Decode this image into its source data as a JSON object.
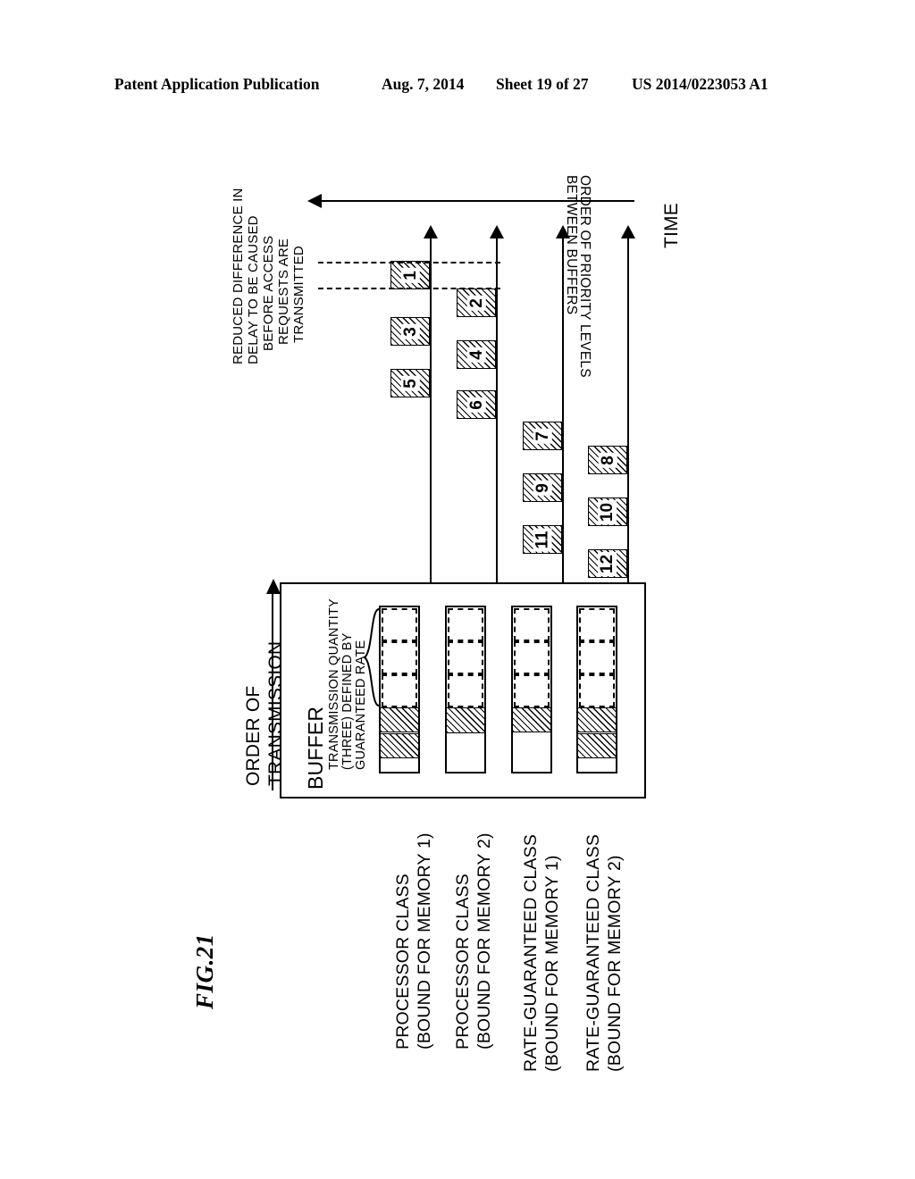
{
  "header": {
    "publication": "Patent Application Publication",
    "date": "Aug. 7, 2014",
    "sheet": "Sheet 19 of 27",
    "number": "US 2014/0223053 A1"
  },
  "figure": {
    "label": "FIG.21",
    "annotations": {
      "reduced_delay": "REDUCED DIFFERENCE IN DELAY TO BE CAUSED BEFORE ACCESS REQUESTS ARE TRANSMITTED",
      "reduced_delay_lines": [
        "REDUCED DIFFERENCE IN",
        "DELAY TO BE CAUSED",
        "BEFORE ACCESS",
        "REQUESTS ARE",
        "TRANSMITTED"
      ],
      "priority_order": "ORDER OF PRIORITY LEVELS BETWEEN BUFFERS",
      "priority_order_lines": [
        "ORDER OF PRIORITY LEVELS",
        "BETWEEN BUFFERS"
      ],
      "time_axis": "TIME",
      "order_of_transmission": "ORDER OF TRANSMISSION",
      "order_of_transmission_lines": [
        "ORDER OF",
        "TRANSMISSION"
      ],
      "buffer_title": "BUFFER",
      "transmission_quantity": "TRANSMISSION QUANTITY (THREE) DEFINED BY GUARANTEED RATE",
      "transmission_quantity_lines": [
        "TRANSMISSION QUANTITY",
        "(THREE) DEFINED BY",
        "GUARANTEED RATE"
      ]
    },
    "rows": [
      {
        "label": "PROCESSOR CLASS (BOUND FOR MEMORY 1)",
        "label_lines": [
          "PROCESSOR CLASS",
          "(BOUND FOR MEMORY 1)"
        ],
        "packets": [
          "1",
          "3",
          "5"
        ],
        "buffer_dashed_slots": 3,
        "buffer_hatched_segments": 2
      },
      {
        "label": "PROCESSOR CLASS (BOUND FOR MEMORY 2)",
        "label_lines": [
          "PROCESSOR CLASS",
          "(BOUND FOR MEMORY 2)"
        ],
        "packets": [
          "2",
          "4",
          "6"
        ],
        "buffer_dashed_slots": 3,
        "buffer_hatched_segments": 1
      },
      {
        "label": "RATE-GUARANTEED CLASS (BOUND FOR MEMORY 1)",
        "label_lines": [
          "RATE-GUARANTEED CLASS",
          "(BOUND FOR MEMORY 1)"
        ],
        "packets": [
          "7",
          "9",
          "11"
        ],
        "buffer_dashed_slots": 3,
        "buffer_hatched_segments": 1
      },
      {
        "label": "RATE-GUARANTEED CLASS (BOUND FOR MEMORY 2)",
        "label_lines": [
          "RATE-GUARANTEED CLASS",
          "(BOUND FOR MEMORY 2)"
        ],
        "packets": [
          "8",
          "10",
          "12"
        ],
        "buffer_dashed_slots": 3,
        "buffer_hatched_segments": 2
      }
    ],
    "packet_order": [
      "1",
      "2",
      "3",
      "4",
      "5",
      "6",
      "7",
      "8",
      "9",
      "10",
      "11",
      "12"
    ]
  }
}
